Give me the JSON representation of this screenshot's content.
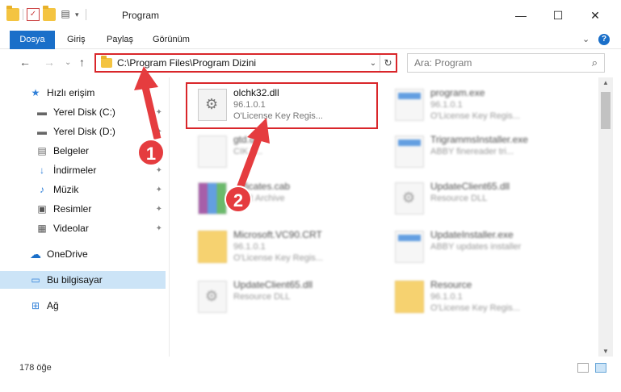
{
  "window": {
    "title": "Program",
    "minimize": "—",
    "maximize": "☐",
    "close": "✕"
  },
  "ribbon": {
    "tabs": [
      "Dosya",
      "Giriş",
      "Paylaş",
      "Görünüm"
    ],
    "expand": "⌄",
    "help": "?"
  },
  "nav": {
    "back": "←",
    "forward": "→",
    "recent": "⌄",
    "up": "↑",
    "address": "C:\\Program Files\\Program Dizini",
    "address_dropdown": "⌄",
    "refresh": "↻",
    "search_placeholder": "Ara: Program",
    "search_icon": "⌕"
  },
  "sidebar": {
    "items": [
      {
        "label": "Hızlı erişim",
        "icon": "star-icon",
        "glyph": "★",
        "pinned": false
      },
      {
        "label": "Yerel Disk (C:)",
        "icon": "drive-icon",
        "glyph": "▬",
        "pinned": true
      },
      {
        "label": "Yerel Disk (D:)",
        "icon": "drive-icon",
        "glyph": "▬",
        "pinned": true
      },
      {
        "label": "Belgeler",
        "icon": "documents-icon",
        "glyph": "▤",
        "pinned": true
      },
      {
        "label": "İndirmeler",
        "icon": "download-icon",
        "glyph": "↓",
        "pinned": true
      },
      {
        "label": "Müzik",
        "icon": "music-icon",
        "glyph": "♪",
        "pinned": true
      },
      {
        "label": "Resimler",
        "icon": "pictures-icon",
        "glyph": "▣",
        "pinned": true
      },
      {
        "label": "Videolar",
        "icon": "videos-icon",
        "glyph": "▦",
        "pinned": true
      },
      {
        "label": "OneDrive",
        "icon": "cloud-icon",
        "glyph": "☁",
        "pinned": false
      },
      {
        "label": "Bu bilgisayar",
        "icon": "computer-icon",
        "glyph": "▭",
        "pinned": false
      },
      {
        "label": "Ağ",
        "icon": "network-icon",
        "glyph": "⊞",
        "pinned": false
      }
    ],
    "pin_glyph": "📌"
  },
  "files": [
    {
      "name": "olchk32.dll",
      "line1": "96.1.0.1",
      "line2": "O'License Key Regis...",
      "icon": "dll-gear"
    },
    {
      "name": "program.exe",
      "line1": "96.1.0.1",
      "line2": "O'License Key Regis...",
      "icon": "exe"
    },
    {
      "name": "gtd.dll",
      "line1": "CIK F...",
      "line2": "",
      "icon": "blank"
    },
    {
      "name": "TrigrammsInstaller.exe",
      "line1": "ABBY finereader tri...",
      "line2": "",
      "icon": "window"
    },
    {
      "name": "...ificates.cab",
      "line1": "...AR Archive",
      "line2": "",
      "icon": "rar"
    },
    {
      "name": "UpdateClient65.dll",
      "line1": "Resource DLL",
      "line2": "",
      "icon": "dll-gear"
    },
    {
      "name": "Microsoft.VC90.CRT",
      "line1": "96.1.0.1",
      "line2": "O'License Key Regis...",
      "icon": "folder-doc"
    },
    {
      "name": "UpdateInstaller.exe",
      "line1": "ABBY updates installer",
      "line2": "",
      "icon": "window"
    },
    {
      "name": "UpdateClient65.dll",
      "line1": "Resource DLL",
      "line2": "",
      "icon": "dll-gear"
    },
    {
      "name": "Resource",
      "line1": "96.1.0.1",
      "line2": "O'License Key Regis...",
      "icon": "folder"
    }
  ],
  "status": {
    "count": "178 öğe"
  },
  "annotations": {
    "badge1": "1",
    "badge2": "2"
  },
  "colors": {
    "accent": "#1a6fc9",
    "highlight": "#d9262a",
    "arrow": "#e53c3f"
  }
}
